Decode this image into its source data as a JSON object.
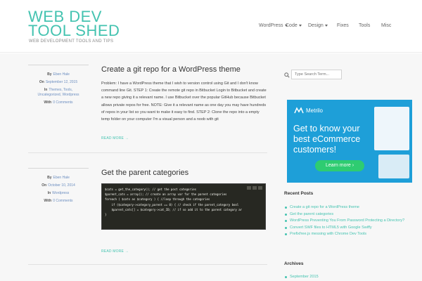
{
  "site": {
    "title": "WEB DEV TOOL SHED",
    "tagline": "WEB DEVELOPMENT TOOLS AND TIPS"
  },
  "nav": {
    "items": [
      {
        "label": "WordPress",
        "dropdown": true
      },
      {
        "label": "Code",
        "dropdown": true
      },
      {
        "label": "Design",
        "dropdown": true
      },
      {
        "label": "Fixes",
        "dropdown": false
      },
      {
        "label": "Tools",
        "dropdown": false
      },
      {
        "label": "Misc",
        "dropdown": false
      }
    ]
  },
  "posts": [
    {
      "author_label": "By",
      "author": "Eben Hale",
      "date_label": "On",
      "date": "September 12, 2015",
      "in_label": "In",
      "categories": "Themes, Tools, Uncategorized, Wordpress",
      "comments_label": "With",
      "comments": "0 Comments",
      "title": "Create a git repo for a WordPress theme",
      "excerpt": "Problem: I have a WordPress theme that I wish to version control using Git and I don't know command line Git. STEP 1: Create the remote git repo in Bitbucket Login to Bitbucket and create a new repo giving it a relevant name. I use Bitbucket over the popular GitHub because Bitbucket allows private repos for free. NOTE: Give it a relevant name as one day you may have hundreds of repos in your list so you want to make it easy to find. STEP 2: Clone the repo into a empty temp folder on your computer I'm a visual person and a noob with git",
      "read_more": "READ MORE →"
    },
    {
      "author_label": "By",
      "author": "Eben Hale",
      "date_label": "On",
      "date": "October 10, 2014",
      "in_label": "In",
      "categories": "Wordpress",
      "comments_label": "With",
      "comments": "0 Comments",
      "title": "Get the parent categories",
      "code": [
        "$cats = get_the_category(); // get the post categories",
        "$parent_cats = array(); // create an array var for the parent categories",
        "",
        "foreach ( $cats as $category ) { //loop through the categories",
        "",
        "    if ($category->category_parent == 0) { // check if the parent_category bool",
        "    $parent_cats[] = $category->cat_ID; // if so add it to the parent category ar",
        "}"
      ],
      "read_more": "READ MORE →"
    }
  ],
  "sidebar": {
    "search_placeholder": "Type Search Term...",
    "ad": {
      "brand": "Metrilo",
      "headline": "Get to know your best eCommerce customers!",
      "button": "Learn more ›"
    },
    "recent_posts_title": "Recent Posts",
    "recent_posts": [
      "Create a git repo for a WordPress theme",
      "Get the parent categories",
      "WordPress Preventing You From Password Protecting a Directory?",
      "Convert SWF files to HTML5 with Google Swiffy",
      "Prefixfree.js messing with Chrome Dev Tools"
    ],
    "archives_title": "Archives",
    "archives": [
      "September 2015"
    ]
  },
  "colors": {
    "accent": "#44c3b0",
    "ad_background": "#1e9fd8",
    "ad_button": "#2ecc71",
    "code_background": "#272822"
  }
}
